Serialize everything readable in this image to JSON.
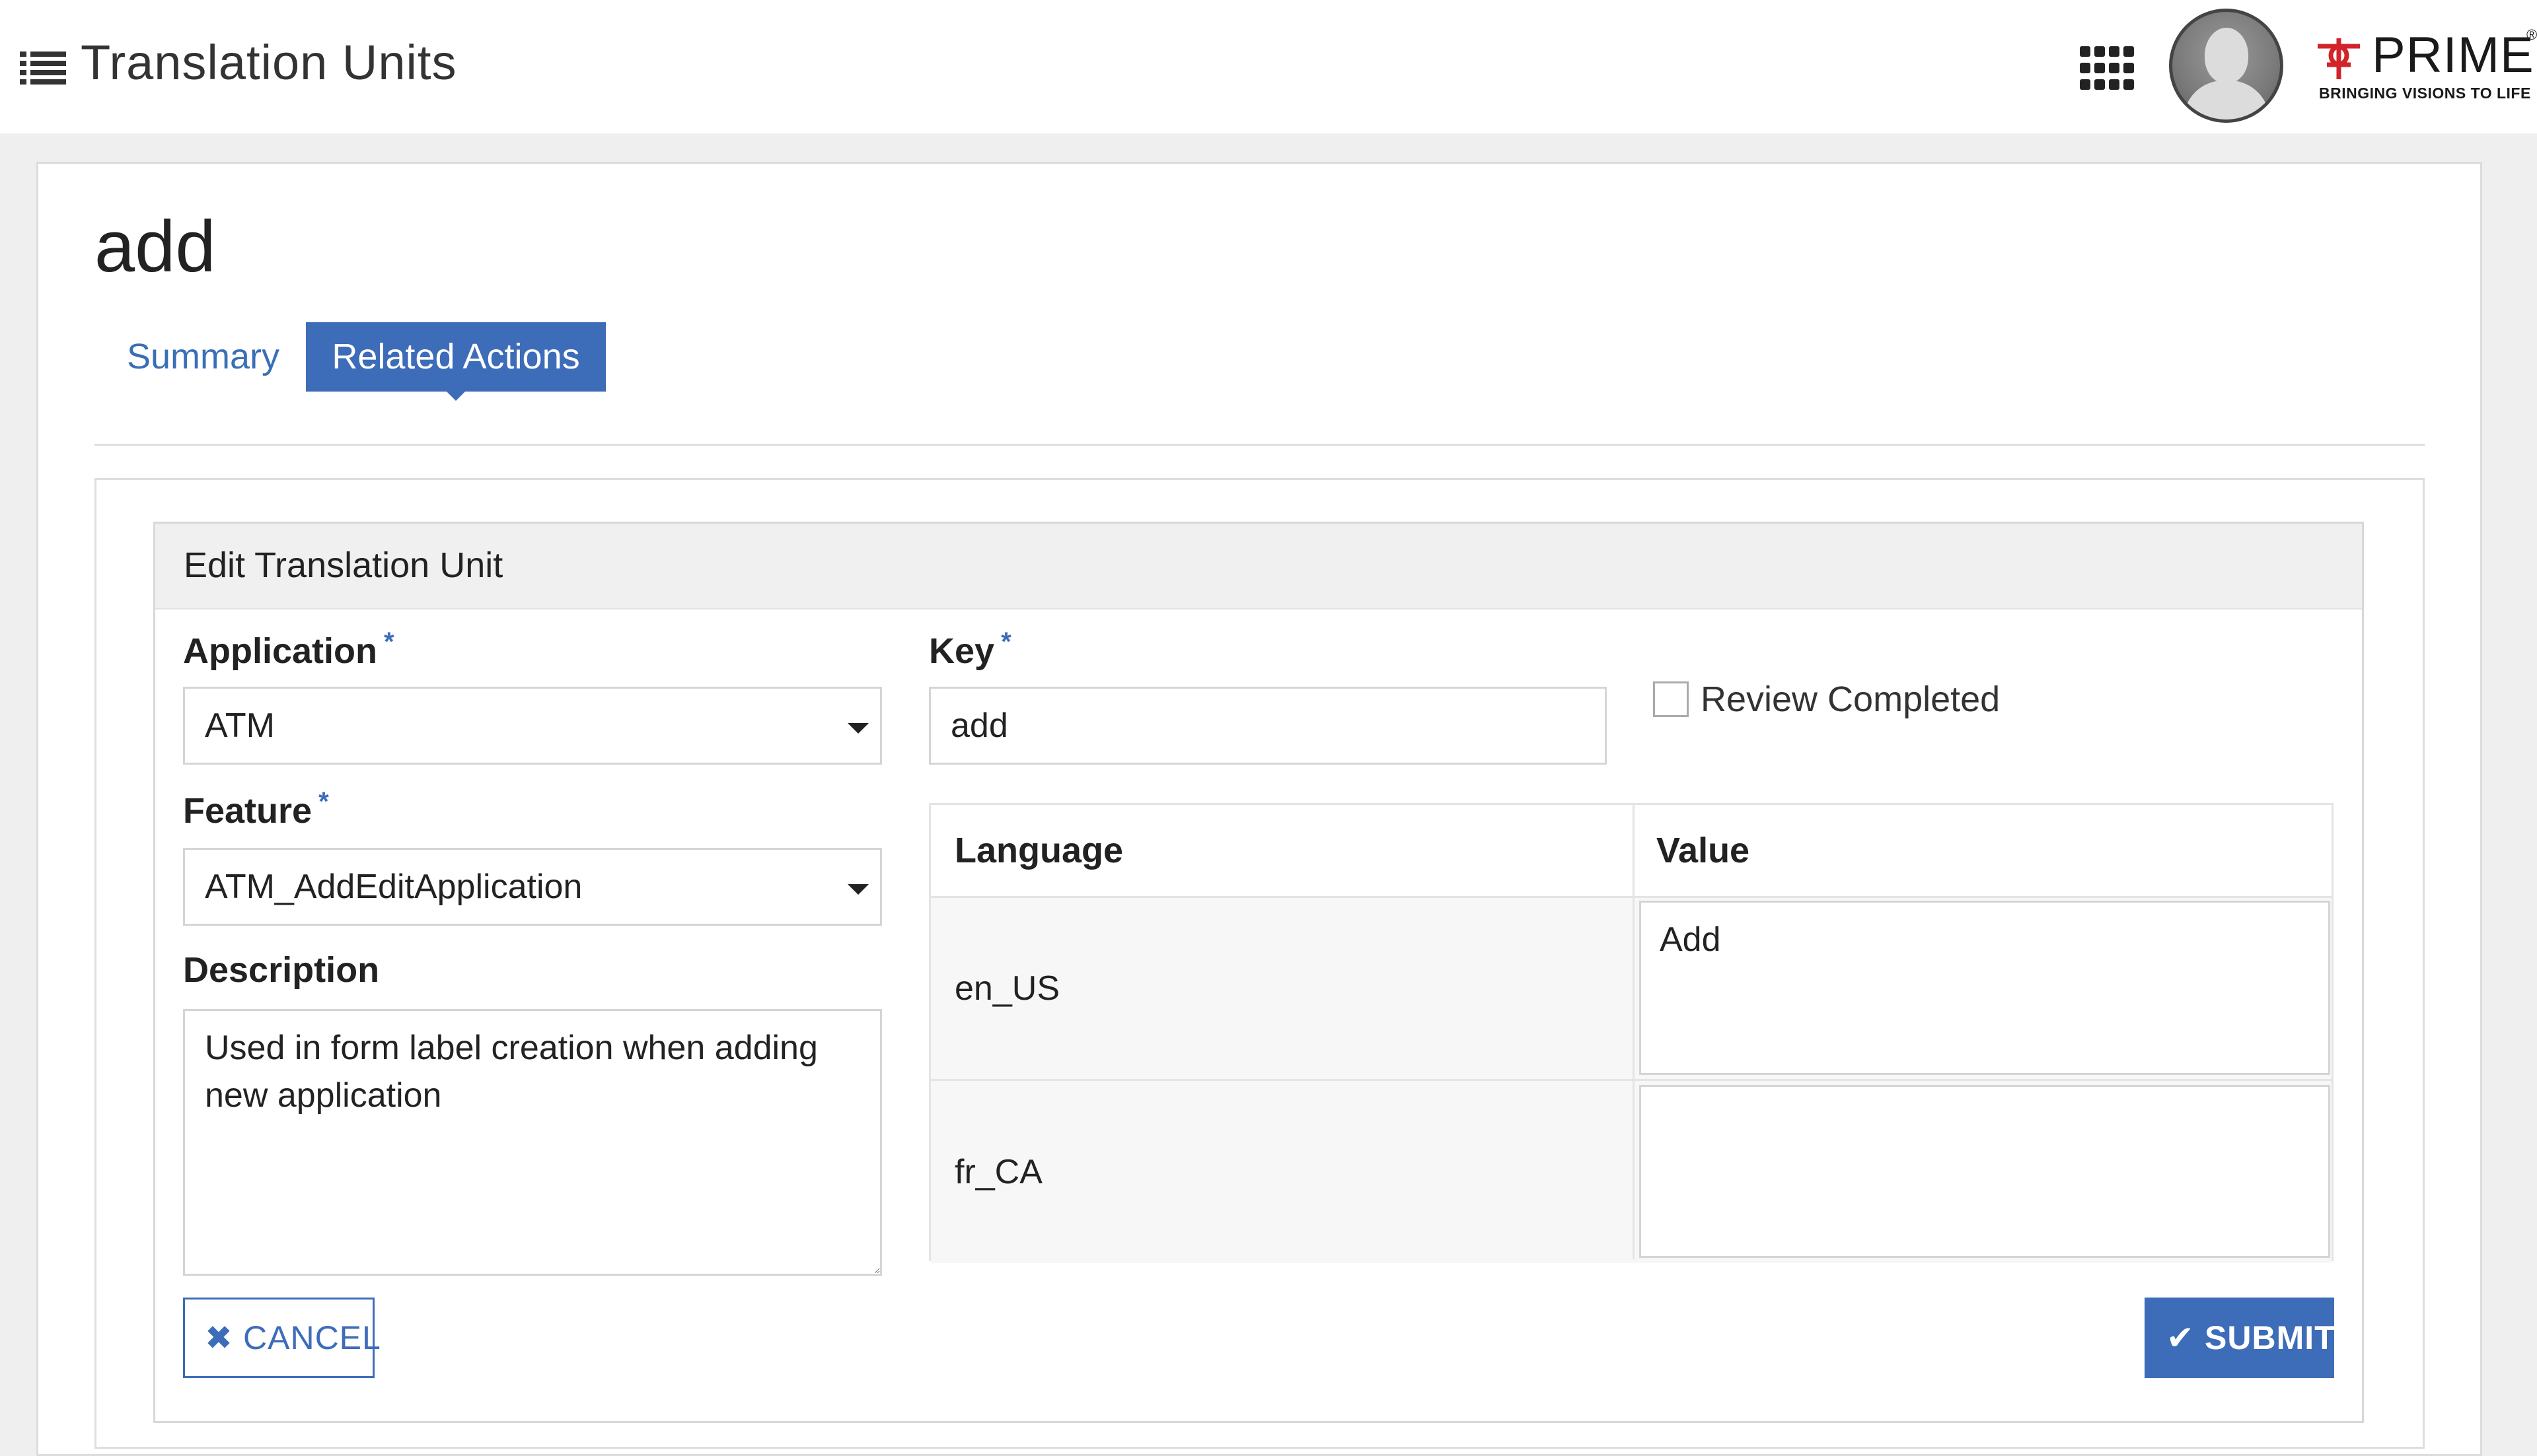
{
  "header": {
    "title": "Translation Units",
    "menu_icon": "list-menu-icon",
    "apps_icon": "apps-grid-icon",
    "avatar_icon": "user-avatar-icon",
    "logo": {
      "name": "PRIME",
      "tagline": "BRINGING VISIONS TO LIFE",
      "registered": "®"
    }
  },
  "record": {
    "title": "add"
  },
  "tabs": [
    {
      "label": "Summary",
      "active": false
    },
    {
      "label": "Related Actions",
      "active": true
    }
  ],
  "form": {
    "title": "Edit Translation Unit",
    "application": {
      "label": "Application",
      "required_mark": "*",
      "value": "ATM"
    },
    "feature": {
      "label": "Feature",
      "required_mark": "*",
      "value": "ATM_AddEditApplication"
    },
    "description": {
      "label": "Description",
      "value": "Used in form label creation when adding new application"
    },
    "key": {
      "label": "Key",
      "required_mark": "*",
      "value": "add"
    },
    "review_completed": {
      "label": "Review Completed",
      "checked": false
    },
    "translations": {
      "columns": [
        "Language",
        "Value"
      ],
      "rows": [
        {
          "language": "en_US",
          "value": "Add"
        },
        {
          "language": "fr_CA",
          "value": ""
        }
      ]
    },
    "cancel_label": "CANCEL",
    "cancel_icon": "close-icon",
    "submit_label": "SUBMIT",
    "submit_icon": "check-icon"
  },
  "colors": {
    "accent": "#3d6cb9",
    "background": "#efefef",
    "panel_header": "#f0f0f0"
  }
}
